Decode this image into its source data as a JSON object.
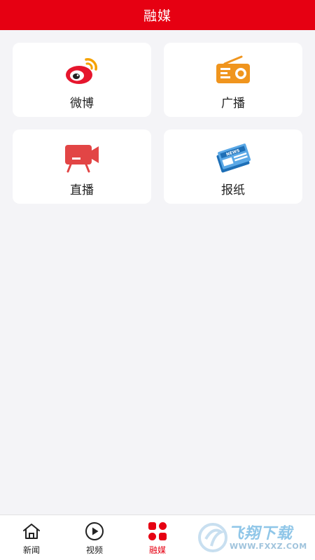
{
  "header": {
    "title": "融媒"
  },
  "cards": [
    {
      "label": "微博",
      "icon": "weibo-icon"
    },
    {
      "label": "广播",
      "icon": "radio-icon"
    },
    {
      "label": "直播",
      "icon": "live-tv-icon"
    },
    {
      "label": "报纸",
      "icon": "newspaper-icon"
    }
  ],
  "newspaper_badge": "NEWS",
  "tabs": [
    {
      "label": "新闻",
      "icon": "home-icon"
    },
    {
      "label": "视频",
      "icon": "play-icon"
    },
    {
      "label": "融媒",
      "icon": "grid-icon",
      "active": true
    },
    {
      "label": "",
      "icon": "obscured-icon"
    },
    {
      "label": "",
      "icon": "obscured-icon"
    }
  ],
  "watermark": {
    "brand": "飞翔下载",
    "url": "WWW.FXXZ.COM"
  },
  "colors": {
    "accent": "#e60012",
    "radio": "#f0951e",
    "live": "#e24545",
    "news": "#1e6fb6",
    "background": "#f4f4f7"
  }
}
